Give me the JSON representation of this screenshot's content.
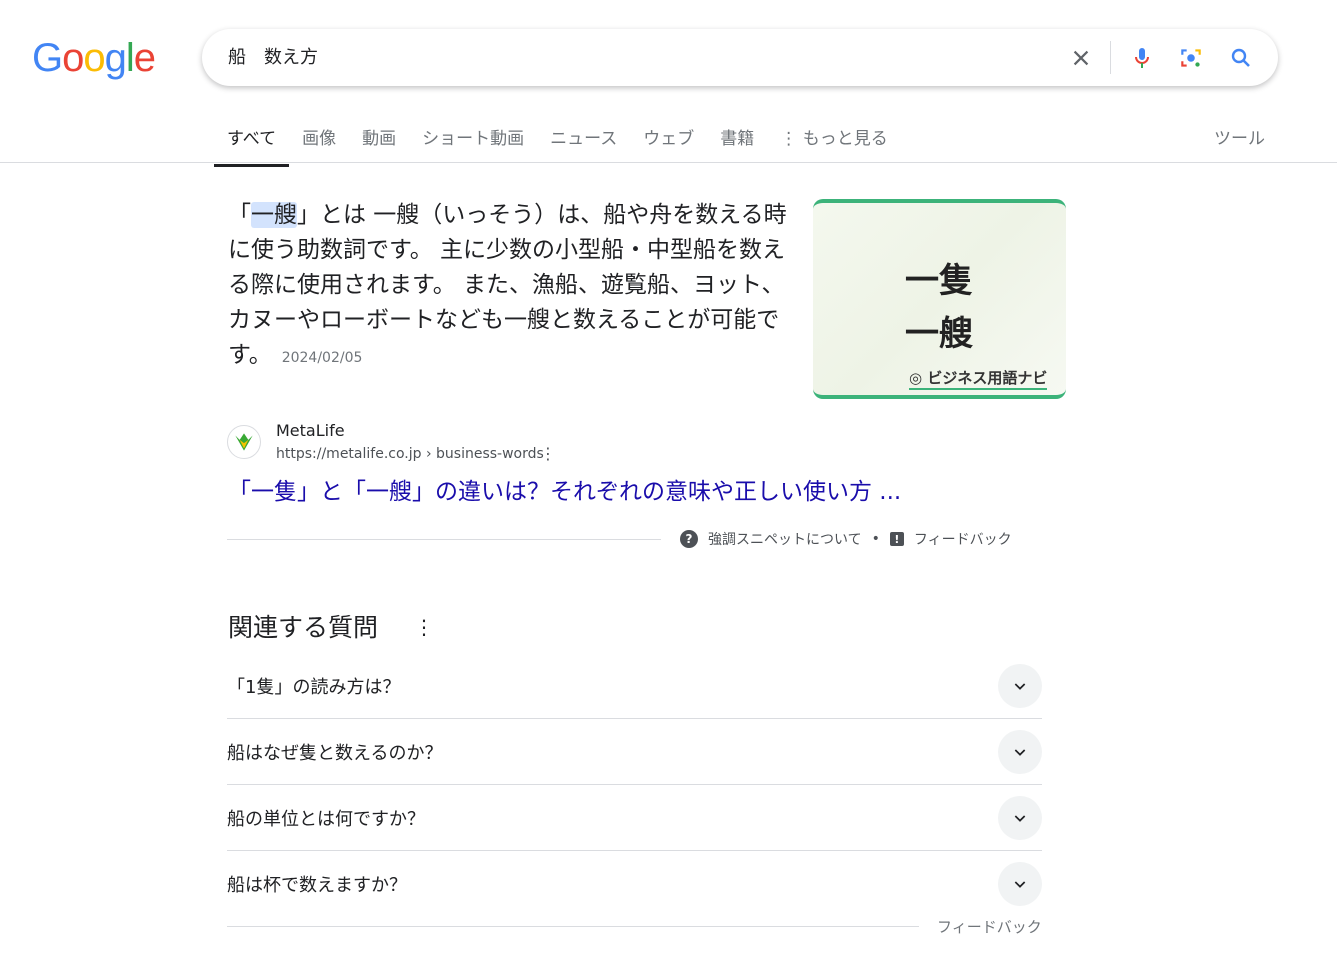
{
  "logo": {
    "letters": [
      "G",
      "o",
      "o",
      "g",
      "l",
      "e"
    ],
    "colors": [
      "#4285f4",
      "#ea4335",
      "#fbbc05",
      "#4285f4",
      "#34a853",
      "#ea4335"
    ]
  },
  "search": {
    "query": "船　数え方"
  },
  "tabs": [
    {
      "label": "すべて",
      "active": true
    },
    {
      "label": "画像"
    },
    {
      "label": "動画"
    },
    {
      "label": "ショート動画"
    },
    {
      "label": "ニュース"
    },
    {
      "label": "ウェブ"
    },
    {
      "label": "書籍"
    },
    {
      "label": "⋮ もっと見る"
    }
  ],
  "tools": "ツール",
  "snippet": {
    "open": "「",
    "highlight": "一艘",
    "rest": "」とは 一艘（いっそう）は、船や舟を数える時に使う助数詞です。 主に少数の小型船・中型船を数える際に使用されます。 また、漁船、遊覧船、ヨット、カヌーやローボートなども一艘と数えることが可能です。",
    "date": "2024/02/05"
  },
  "thumbnail": {
    "line1": "一隻",
    "line2": "一艘",
    "brand": "ビジネス用語ナビ"
  },
  "result": {
    "site": "MetaLife",
    "url": "https://metalife.co.jp › business-words",
    "title": "「一隻」と「一艘」の違いは？それぞれの意味や正しい使い方 ..."
  },
  "snippet_footer": {
    "about": "強調スニペットについて",
    "feedback": "フィードバック"
  },
  "related": {
    "title": "関連する質問",
    "questions": [
      "「1隻」の読み方は？",
      "船はなぜ隻と数えるのか？",
      "船の単位とは何ですか？",
      "船は杯で数えますか？"
    ],
    "feedback": "フィードバック"
  }
}
